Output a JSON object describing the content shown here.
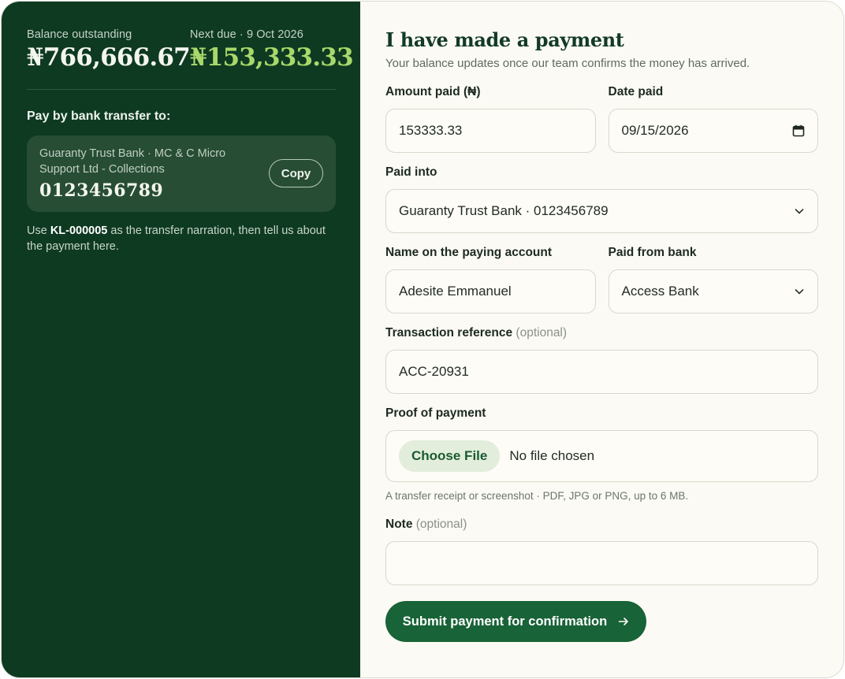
{
  "summary": {
    "balance_label": "Balance outstanding",
    "balance_amount": "₦766,666.67",
    "next_due_label": "Next due · 9 Oct 2026",
    "next_due_amount": "₦153,333.33"
  },
  "transfer": {
    "heading": "Pay by bank transfer to:",
    "bank_name": "Guaranty Trust Bank · MC & C Micro Support Ltd - Collections",
    "account_number": "0123456789",
    "copy_label": "Copy",
    "narration_prefix": "Use",
    "narration_code": "KL-000005",
    "narration_suffix": "as the transfer narration, then tell us about the payment here."
  },
  "form": {
    "title": "I have made a payment",
    "subtitle": "Your balance updates once our team confirms the money has arrived.",
    "amount_label": "Amount paid (₦)",
    "amount_value": "153333.33",
    "date_label": "Date paid",
    "date_value": "09/15/2026",
    "paid_into_label": "Paid into",
    "paid_into_value": "Guaranty Trust Bank · 0123456789",
    "payer_name_label": "Name on the paying account",
    "payer_name_value": "Adesite Emmanuel",
    "paid_from_label": "Paid from bank",
    "paid_from_value": "Access Bank",
    "reference_label": "Transaction reference",
    "reference_optional": "(optional)",
    "reference_value": "ACC-20931",
    "proof_label": "Proof of payment",
    "choose_file_label": "Choose File",
    "no_file_text": "No file chosen",
    "proof_hint": "A transfer receipt or screenshot · PDF, JPG or PNG, up to 6 MB.",
    "note_label": "Note",
    "note_optional": "(optional)",
    "note_value": "",
    "submit_label": "Submit payment for confirmation"
  },
  "colors": {
    "panel_dark": "#0e3a22",
    "accent_green": "#a8d86a",
    "primary_button": "#186337",
    "file_button_bg": "#e2eedb"
  },
  "icons": [
    "calendar-icon",
    "chevron-down-icon",
    "arrow-right-icon"
  ]
}
